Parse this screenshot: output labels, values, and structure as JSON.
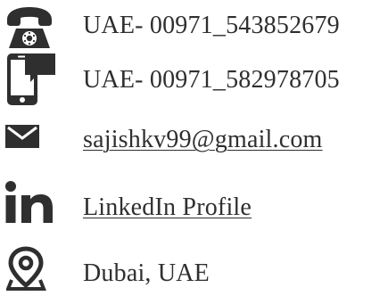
{
  "contacts": {
    "phone": {
      "icon": "telephone-icon",
      "text": "UAE- 00971_543852679"
    },
    "mobile": {
      "icon": "mobile-chat-icon",
      "text": "UAE- 00971_582978705"
    },
    "email": {
      "icon": "envelope-icon",
      "text": "sajishkv99@gmail.com"
    },
    "linkedin": {
      "icon": "linkedin-icon",
      "text": "LinkedIn Profile"
    },
    "location": {
      "icon": "location-pin-icon",
      "text": "Dubai, UAE"
    }
  },
  "colors": {
    "icon": "#2f2f2f",
    "text": "#2f2f2f",
    "background": "#ffffff"
  }
}
